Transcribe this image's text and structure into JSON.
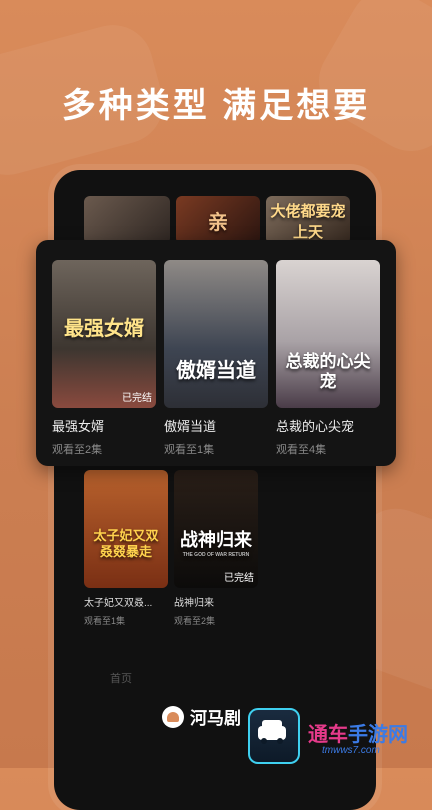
{
  "headline": "多种类型 满足想要",
  "top_row": [
    {
      "title": ""
    },
    {
      "title": "亲"
    },
    {
      "title": "大佬都要宠上天"
    }
  ],
  "featured": [
    {
      "poster_title": "最强女婿",
      "badge": "已完结",
      "name": "最强女婿",
      "progress": "观看至2集"
    },
    {
      "poster_title": "傲婿当道",
      "badge": "",
      "name": "傲婿当道",
      "progress": "观看至1集"
    },
    {
      "poster_title": "总裁的心尖宠",
      "badge": "",
      "name": "总裁的心尖宠",
      "progress": "观看至4集"
    }
  ],
  "lower": [
    {
      "poster_title": "太子妃又双叒叕暴走",
      "badge": "",
      "name": "太子妃又双叒...",
      "progress": "观看至1集"
    },
    {
      "poster_title": "战神归来",
      "poster_subtitle": "THE GOD OF WAR RETURN",
      "badge": "已完结",
      "name": "战神归来",
      "progress": "观看至2集"
    }
  ],
  "tabbar": {
    "home": "首页"
  },
  "brand": "河马剧",
  "watermark": {
    "text_a": "通车",
    "text_b": "手游网",
    "sub": "tmwws7.com"
  }
}
